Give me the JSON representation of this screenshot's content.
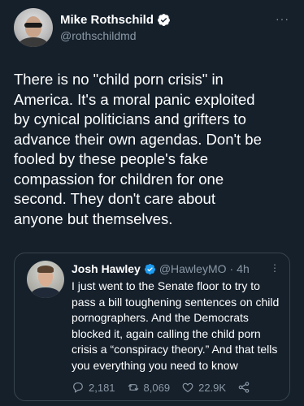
{
  "tweet": {
    "author_name": "Mike Rothschild",
    "author_handle": "@rothschildmd",
    "more_icon": "ellipsis-icon",
    "text": "There is no \"child porn crisis\" in\nAmerica. It's a moral panic exploited\nby cynical politicians and grifters to\nadvance their own agendas. Don't be\nfooled by these people's fake\ncompassion for children for one\nsecond. They don't care about\nanyone but themselves."
  },
  "quoted_tweet": {
    "author_name": "Josh Hawley",
    "author_handle": "@HawleyMO",
    "separator": "·",
    "time": "4h",
    "text": "I just went to the Senate floor to try to pass a bill toughening sentences on child pornographers. And the Democrats blocked it, again calling the child porn crisis a “conspiracy theory.” And that tells you everything you need to know",
    "stats": {
      "replies": "2,181",
      "retweets": "8,069",
      "likes": "22.9K"
    }
  },
  "colors": {
    "background": "#15202b",
    "text": "#ffffff",
    "secondary": "#8b98a5",
    "verified": "#1d9bf0",
    "border": "#38444d"
  }
}
